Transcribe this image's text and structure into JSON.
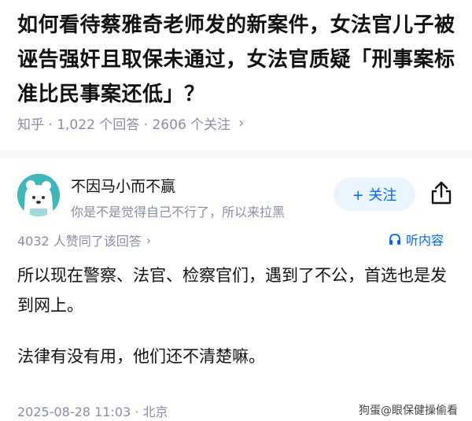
{
  "question": {
    "title": "如何看待蔡雅奇老师发的新案件，女法官儿子被诬告强奸且取保未通过，女法官质疑「刑事案标准比民事案还低」？",
    "meta": "知乎 · 1,022 个回答 · 2606 个关注"
  },
  "author": {
    "name": "不因马小而不赢",
    "bio": "你是不是觉得自己不行了，所以来拉黑",
    "avatar_icon": "cartoon-avatar-icon"
  },
  "actions": {
    "follow_label": "+ 关注",
    "share_icon": "share-icon"
  },
  "answer": {
    "upvotes": "4032 人赞同了该回答",
    "listen_label": "听内容",
    "paragraphs": [
      "所以现在警察、法官、检察官们，遇到了不公，首选也是发到网上。",
      "法律有没有用，他们还不清楚嘛。"
    ],
    "footer": "2025-08-28 11:03 · 北京"
  },
  "watermark": "狗蛋@眼保健操偷看",
  "colors": {
    "accent": "#0066ff",
    "muted": "#8590a6",
    "avatar_bg": "#3fb6ba",
    "follow_bg": "#ebf5ff"
  }
}
